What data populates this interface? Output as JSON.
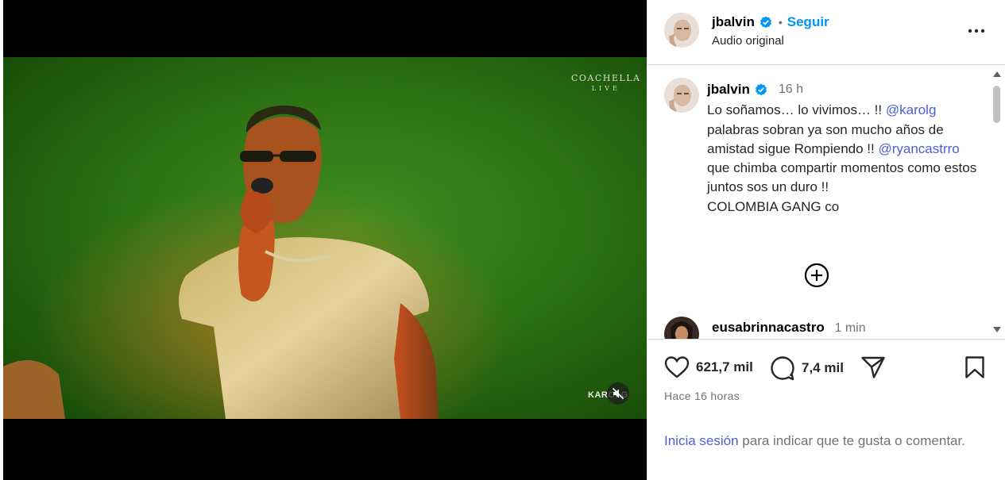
{
  "video": {
    "watermark_top": "COACHELLA",
    "watermark_top_sub": "LIVE",
    "watermark_bottom": "KAROLG",
    "mute_icon": "speaker-muted-icon"
  },
  "header": {
    "username": "jbalvin",
    "separator": "•",
    "follow_label": "Seguir",
    "audio_label": "Audio original",
    "more_icon": "more-horizontal-icon"
  },
  "caption": {
    "username": "jbalvin",
    "time": "16 h",
    "part1": "Lo soñamos… lo vivimos… !! ",
    "mention1": "@karolg",
    "part2": " palabras sobran ya son mucho años de amistad sigue Rompiendo !! ",
    "mention2": "@ryancastrro",
    "part3": " que chimba compartir momentos como estos juntos sos un duro !!",
    "part4": "COLOMBIA GANG co"
  },
  "load_more_icon": "plus-circle-icon",
  "comment2": {
    "username": "eusabrinnacastro",
    "time": "1 min"
  },
  "actions": {
    "likes": "621,7 mil",
    "comments": "7,4 mil",
    "posted_ago": "Hace 16 horas",
    "login_link": "Inicia sesión",
    "login_rest": " para indicar que te gusta o comentar."
  },
  "colors": {
    "link_blue": "#0095f6",
    "mention_blue": "#4a5fd6",
    "verified_blue": "#0095f6",
    "muted_text": "#737373",
    "divider": "#dbdbdb"
  }
}
